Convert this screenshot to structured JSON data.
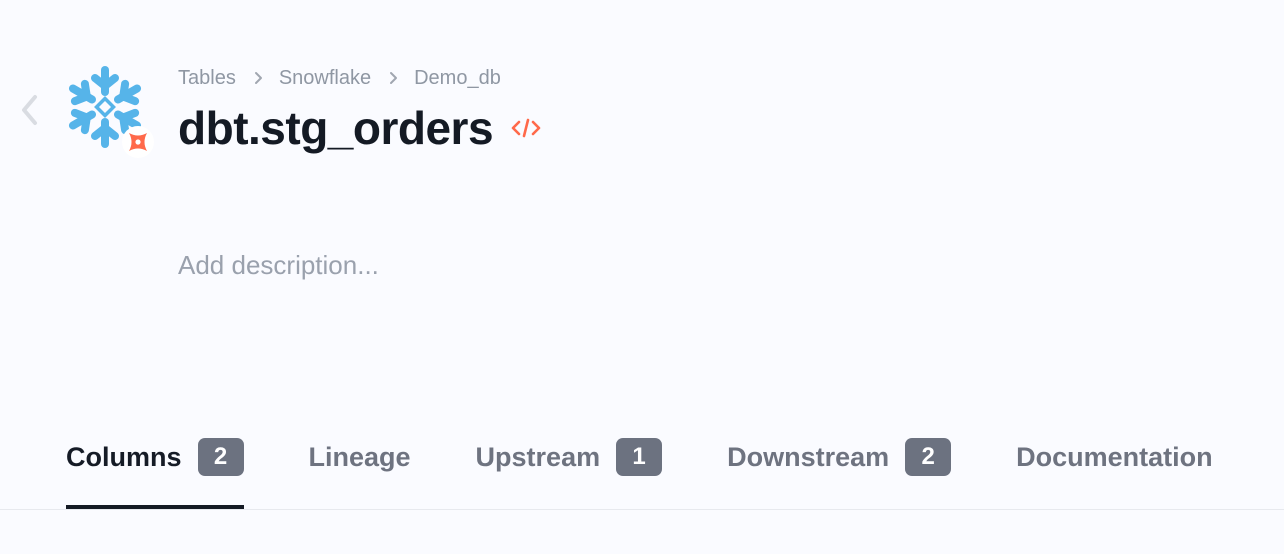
{
  "breadcrumb": [
    "Tables",
    "Snowflake",
    "Demo_db"
  ],
  "title": "dbt.stg_orders",
  "description_placeholder": "Add description...",
  "icons": {
    "back": "chevron-left-icon",
    "source": "snowflake-logo",
    "badge": "dbt-logo",
    "code": "code-icon",
    "separator": "chevron-right-icon"
  },
  "tabs": [
    {
      "label": "Columns",
      "count": "2",
      "active": true
    },
    {
      "label": "Lineage"
    },
    {
      "label": "Upstream",
      "count": "1"
    },
    {
      "label": "Downstream",
      "count": "2"
    },
    {
      "label": "Documentation"
    }
  ],
  "colors": {
    "background": "#fafbff",
    "snowflake": "#56b4e9",
    "dbt": "#ff694a",
    "title": "#141a24",
    "muted": "#8f97a3",
    "badge": "#6c7280"
  }
}
